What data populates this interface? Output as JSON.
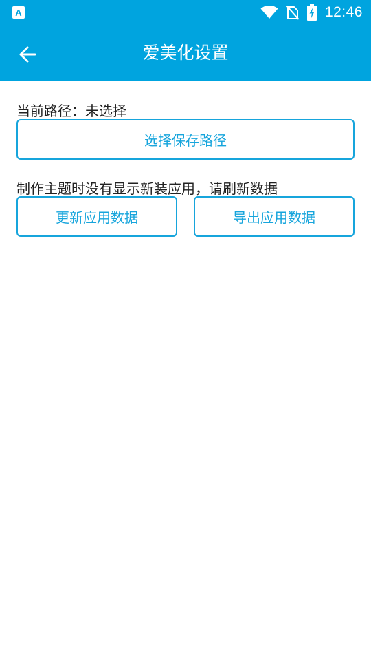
{
  "status_bar": {
    "time": "12:46",
    "left_icon": "notification-a-icon",
    "right_icons": [
      "wifi-icon",
      "no-sim-icon",
      "battery-charging-icon"
    ]
  },
  "toolbar": {
    "title": "爱美化设置",
    "back_icon": "arrow-back-icon"
  },
  "path_section": {
    "label": "当前路径：未选择",
    "button": "选择保存路径"
  },
  "apps_section": {
    "label": "制作主题时没有显示新装应用，请刷新数据",
    "update_button": "更新应用数据",
    "export_button": "导出应用数据"
  },
  "colors": {
    "primary": "#00a4df",
    "button_text": "#17a5dc",
    "label_text": "#222222"
  }
}
